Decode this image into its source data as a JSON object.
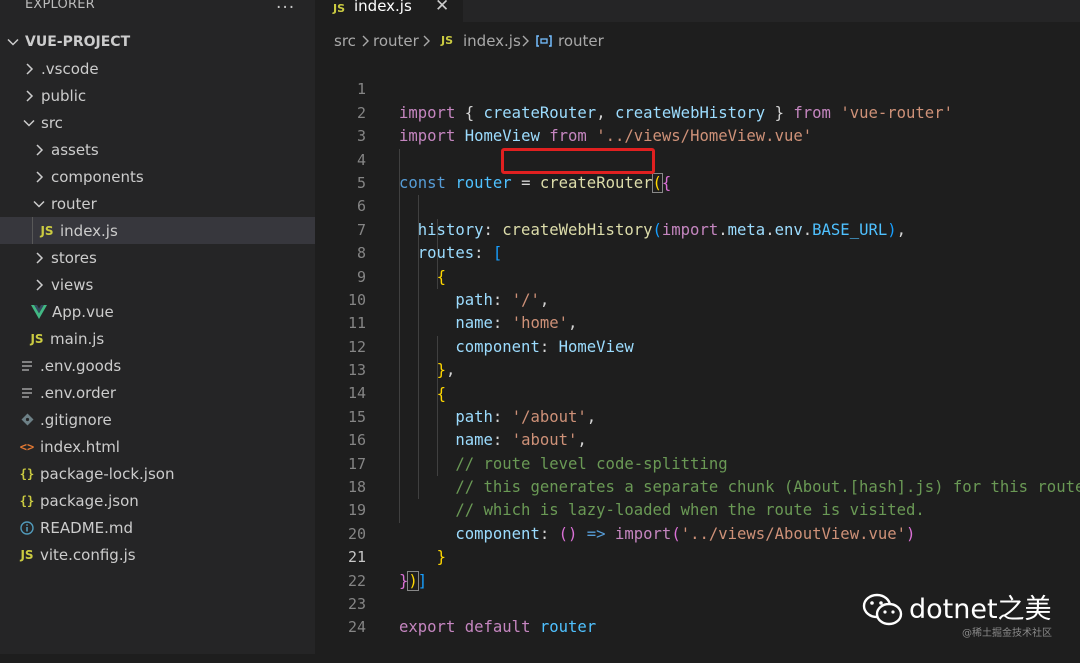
{
  "sidebar": {
    "title": "EXPLORER",
    "more_icon": "...",
    "project": "VUE-PROJECT",
    "items": [
      {
        "label": ".vscode",
        "type": "folder",
        "icon": "chevron-right-icon"
      },
      {
        "label": "public",
        "type": "folder",
        "icon": "chevron-right-icon"
      },
      {
        "label": "src",
        "type": "folder-open",
        "icon": "chevron-down-icon"
      },
      {
        "label": "assets",
        "type": "folder",
        "icon": "chevron-right-icon"
      },
      {
        "label": "components",
        "type": "folder",
        "icon": "chevron-right-icon"
      },
      {
        "label": "router",
        "type": "folder-open",
        "icon": "chevron-down-icon"
      },
      {
        "label": "index.js",
        "type": "js-file",
        "icon": "js-file-icon",
        "selected": true
      },
      {
        "label": "stores",
        "type": "folder",
        "icon": "chevron-right-icon"
      },
      {
        "label": "views",
        "type": "folder",
        "icon": "chevron-right-icon"
      },
      {
        "label": "App.vue",
        "type": "vue-file",
        "icon": "vue-file-icon"
      },
      {
        "label": "main.js",
        "type": "js-file",
        "icon": "js-file-icon"
      },
      {
        "label": ".env.goods",
        "type": "env-file",
        "icon": "lines-file-icon"
      },
      {
        "label": ".env.order",
        "type": "env-file",
        "icon": "lines-file-icon"
      },
      {
        "label": ".gitignore",
        "type": "git-file",
        "icon": "git-diamond-icon"
      },
      {
        "label": "index.html",
        "type": "html-file",
        "icon": "html-file-icon"
      },
      {
        "label": "package-lock.json",
        "type": "json-file",
        "icon": "json-braces-icon"
      },
      {
        "label": "package.json",
        "type": "json-file",
        "icon": "json-braces-icon"
      },
      {
        "label": "README.md",
        "type": "info-file",
        "icon": "info-circle-icon"
      },
      {
        "label": "vite.config.js",
        "type": "js-file",
        "icon": "js-file-icon"
      }
    ]
  },
  "tab": {
    "label": "index.js",
    "icon_text": "JS"
  },
  "breadcrumb": {
    "parts": [
      "src",
      "router",
      "index.js",
      "router"
    ],
    "js_icon_text": "JS"
  },
  "code": {
    "current_line": "21",
    "line_numbers": [
      "1",
      "2",
      "3",
      "4",
      "5",
      "6",
      "7",
      "8",
      "9",
      "10",
      "11",
      "12",
      "13",
      "14",
      "15",
      "16",
      "17",
      "18",
      "19",
      "20",
      "21",
      "22",
      "23",
      "24"
    ],
    "tokens": {
      "import": "import",
      "from": "from",
      "const": "const",
      "export": "export",
      "default": "default",
      "createRouter": "createRouter",
      "createWebHistory": "createWebHistory",
      "HomeView": "HomeView",
      "router": "router",
      "vue_router_str": "'vue-router'",
      "homeview_path_str": "'../views/HomeView.vue'",
      "history": "history",
      "import_kw2": "import",
      "meta": "meta",
      "env": "env",
      "BASE_URL": "BASE_URL",
      "routes": "routes",
      "path": "path",
      "name": "name",
      "component": "component",
      "root_path_str": "'/'",
      "home_str": "'home'",
      "about_path_str": "'/about'",
      "about_str": "'about'",
      "comment1": "// route level code-splitting",
      "comment2": "// this generates a separate chunk (About.[hash].js) for this route",
      "comment3": "// which is lazy-loaded when the route is visited.",
      "arrow": "=>",
      "aboutview_path_str": "'../views/AboutView.vue'"
    }
  },
  "watermark": {
    "title": "dotnet之美",
    "subtitle": "@稀土掘金技术社区"
  },
  "colors": {
    "highlight_box": "#e02020",
    "sidebar_bg": "#252526",
    "editor_bg": "#1e1e1e"
  }
}
